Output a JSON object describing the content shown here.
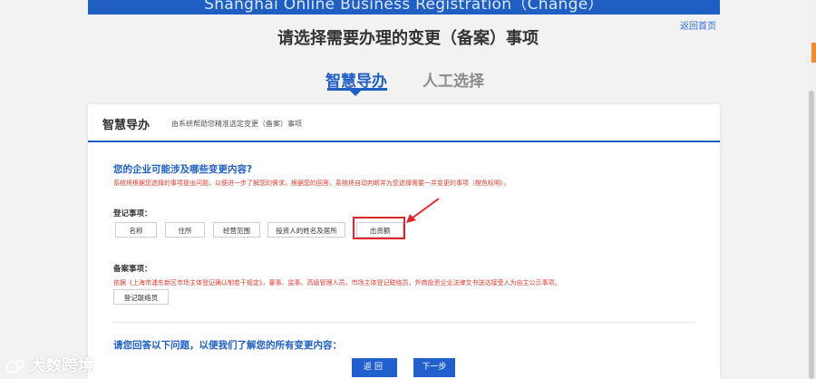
{
  "banner": {
    "text": "Shanghai Online Business Registration（Change）"
  },
  "header": {
    "home_link": "返回首页"
  },
  "page_title": "请选择需要办理的变更（备案）事项",
  "tabs": [
    {
      "label": "智慧导办",
      "active": true
    },
    {
      "label": "人工选择",
      "active": false
    }
  ],
  "card": {
    "title": "智慧导办",
    "subtitle": "由系统帮助您精准选定变更（备案）事项",
    "question_title": "您的企业可能涉及哪些变更内容?",
    "question_desc": "系统将根据您选择的事项提出问题，以便进一步了解您的需求。根据您的回答，系统将自动判断并为您选择需要一并变更的事项（橙色标明）。",
    "registration_label": "登记事项：",
    "registration_options": [
      "名称",
      "住所",
      "经营范围",
      "投资人的姓名及居所",
      "出资额"
    ],
    "filing_label": "备案事项：",
    "filing_desc": "依据《上海市浦东新区市场主体登记确认制若干规定》，董事、监事、高级管理人员，市场主体登记联络员，外商投资企业法律文书送达接受人为自主公示事项。",
    "filing_option": "登记联络员",
    "ask_title": "请您回答以下问题，以便我们了解您的所有变更内容：",
    "back_button": "返回",
    "next_button": "下一步"
  },
  "watermark": {
    "text": "大数跨境"
  },
  "colors": {
    "primary": "#1f5fc4",
    "warning_text": "#e03a2f",
    "highlight_box": "#e0262b",
    "scroll_accent": "#f28a30"
  }
}
